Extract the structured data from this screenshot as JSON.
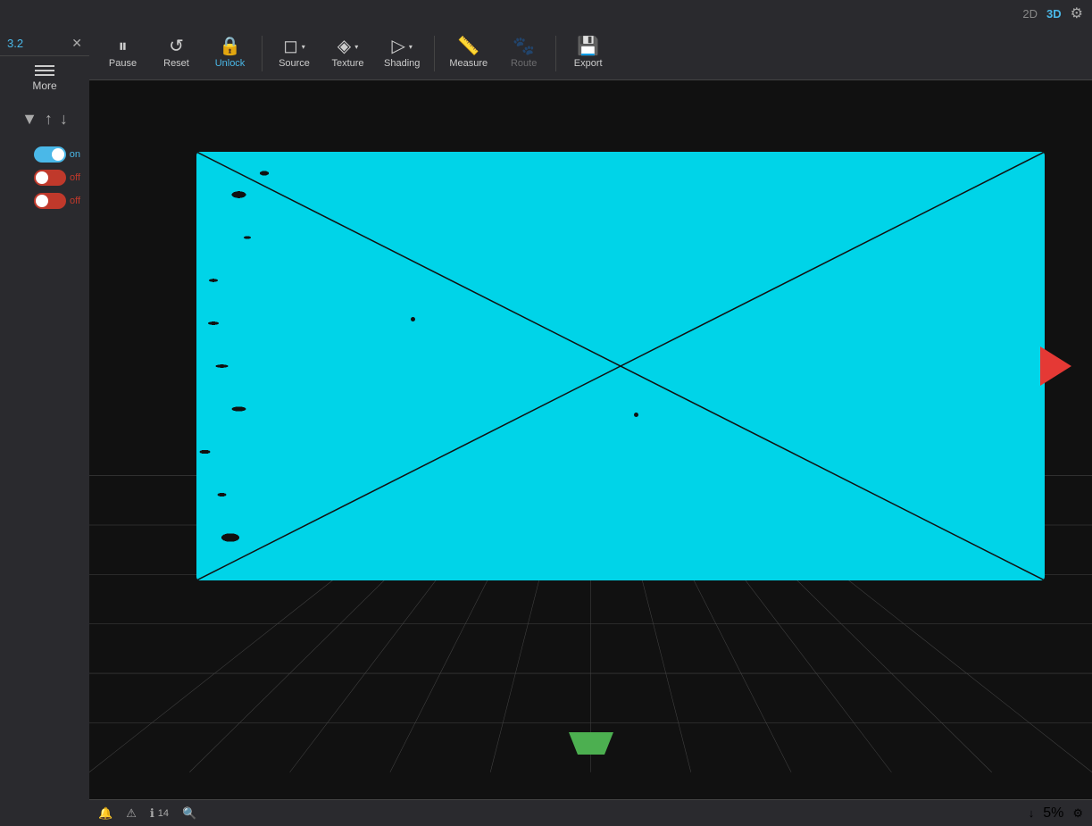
{
  "topbar": {
    "view_2d": "2D",
    "view_3d": "3D",
    "settings_icon": "⚙"
  },
  "sidebar": {
    "version": "3.2",
    "close_icon": "✕",
    "menu_icon": "☰",
    "more_label": "More",
    "upload_icon": "↑",
    "download_icon": "↓",
    "collapse_icon": "▼",
    "toggles": [
      {
        "state": "on",
        "label": "on",
        "color": "on"
      },
      {
        "state": "off",
        "label": "off",
        "color": "off"
      },
      {
        "state": "off",
        "label": "off",
        "color": "off"
      }
    ]
  },
  "toolbar": {
    "buttons": [
      {
        "id": "pause",
        "icon": "⏸",
        "label": "Pause",
        "active": false
      },
      {
        "id": "reset",
        "icon": "↺",
        "label": "Reset",
        "active": false
      },
      {
        "id": "unlock",
        "icon": "🔒",
        "label": "Unlock",
        "active": true
      },
      {
        "id": "source",
        "icon": "◻",
        "label": "Source",
        "active": false,
        "dropdown": true
      },
      {
        "id": "texture",
        "icon": "◈",
        "label": "Texture",
        "active": false,
        "dropdown": true
      },
      {
        "id": "shading",
        "icon": "▷",
        "label": "Shading",
        "active": false,
        "dropdown": true
      },
      {
        "id": "measure",
        "icon": "📏",
        "label": "Measure",
        "active": false
      },
      {
        "id": "route",
        "icon": "🐾",
        "label": "Route",
        "active": false,
        "dimmed": true
      },
      {
        "id": "export",
        "icon": "💾",
        "label": "Export",
        "active": false
      }
    ]
  },
  "statusbar": {
    "left_items": [
      {
        "id": "info1",
        "icon": "🔔",
        "text": ""
      },
      {
        "id": "info2",
        "icon": "⚠",
        "text": ""
      },
      {
        "id": "info3",
        "icon": "ℹ",
        "text": "14"
      },
      {
        "id": "info4",
        "icon": "🔍",
        "text": ""
      }
    ],
    "right_items": [
      {
        "id": "download-icon",
        "icon": "↓",
        "text": ""
      },
      {
        "id": "zoom",
        "text": "5%"
      },
      {
        "id": "settings",
        "icon": "⚙",
        "text": ""
      }
    ]
  }
}
